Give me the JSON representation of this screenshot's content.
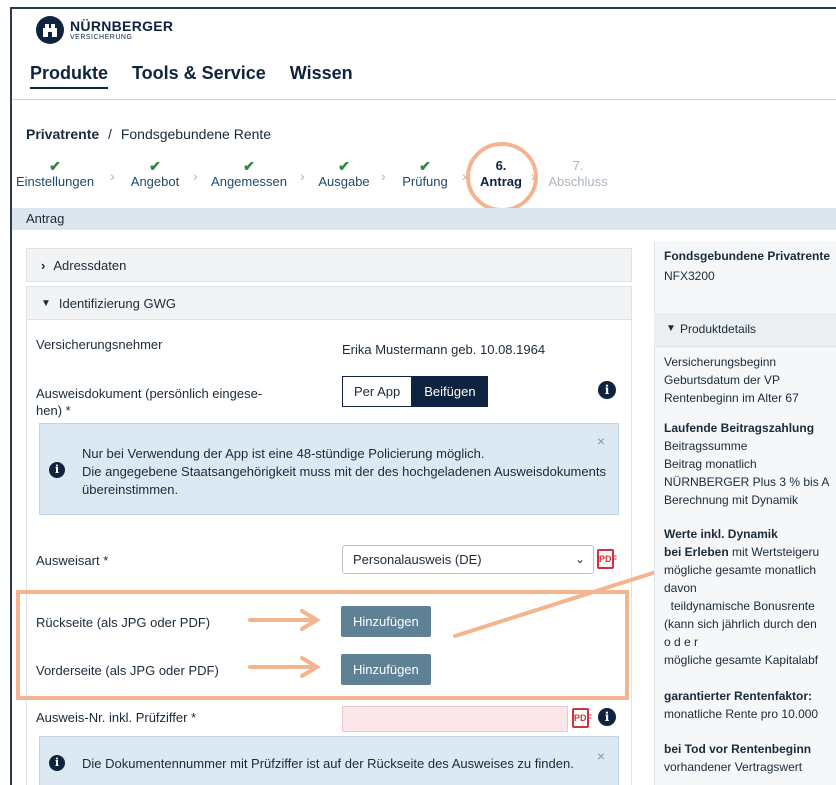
{
  "brand": {
    "name": "NÜRNBERGER",
    "sub": "VERSICHERUNG"
  },
  "nav": [
    "Produkte",
    "Tools & Service",
    "Wissen"
  ],
  "breadcrumb": {
    "root": "Privatrente",
    "separator": "/",
    "current": "Fondsgebundene Rente"
  },
  "steps": [
    {
      "mark": "✔",
      "label": "Einstellungen"
    },
    {
      "mark": "✔",
      "label": "Angebot"
    },
    {
      "mark": "✔",
      "label": "Angemessen"
    },
    {
      "mark": "✔",
      "label": "Ausgabe"
    },
    {
      "mark": "✔",
      "label": "Prüfung"
    },
    {
      "mark": "6.",
      "label": "Antrag"
    },
    {
      "mark": "7.",
      "label": "Abschluss"
    }
  ],
  "section_title": "Antrag",
  "accordion": {
    "address": "Adressdaten",
    "identification": "Identifizierung GWG"
  },
  "form": {
    "policyholder_label": "Versicherungsnehmer",
    "policyholder_value": "Erika Mustermann geb. 10.08.1964",
    "id_doc_label_1": "Ausweisdokument (persönlich eingese-",
    "id_doc_label_2": "hen) *",
    "seg_app": "Per App",
    "seg_attach": "Beifügen",
    "note1_line1": "Nur bei Verwendung der App ist eine 48-stündige Policierung möglich.",
    "note1_line2": "Die angegebene Staatsangehörigkeit muss mit der des hochgeladenen Ausweisdokuments",
    "note1_line3": "übereinstimmen.",
    "id_type_label": "Ausweisart *",
    "id_type_value": "Personalausweis (DE)",
    "back_label": "Rückseite (als JPG oder PDF)",
    "front_label": "Vorderseite (als JPG oder PDF)",
    "add_button": "Hinzufügen",
    "id_number_label": "Ausweis-Nr. inkl. Prüfziffer *",
    "note2": "Die Dokumentennummer mit Prüfziffer ist auf der Rückseite des Ausweises zu finden.",
    "close": "×",
    "info": "i",
    "pdf": "PDF"
  },
  "right_panel": {
    "title": "Fondsgebundene Privatrente",
    "code": "NFX3200",
    "details_header": "Produktdetails",
    "lines": [
      "Versicherungsbeginn",
      "Geburtsdatum der VP",
      "Rentenbeginn im Alter 67"
    ],
    "contrib_title": "Laufende Beitragszahlung",
    "contrib_lines": [
      "Beitragssumme",
      "Beitrag monatlich",
      "NÜRNBERGER Plus 3 % bis A",
      "Berechnung mit Dynamik"
    ],
    "values_title": "Werte inkl. Dynamik",
    "values_sub_bold": "bei Erleben",
    "values_sub_rest": " mit Wertsteigeru",
    "values_lines": [
      "mögliche gesamte monatlich",
      "davon",
      "  teildynamische Bonusrente",
      "(kann sich jährlich durch den",
      "o d e r",
      "mögliche gesamte Kapitalabf"
    ],
    "factor_title": "garantierter Rentenfaktor:",
    "factor_line": "monatliche Rente pro 10.000",
    "death_title": "bei Tod vor Rentenbeginn",
    "death_line": "vorhandener Vertragswert"
  },
  "colors": {
    "primary": "#0d2340",
    "highlight": "#f5b490",
    "button": "#5e8196",
    "info_bg": "#dce9f3",
    "error_bg": "#fbe6ea"
  }
}
